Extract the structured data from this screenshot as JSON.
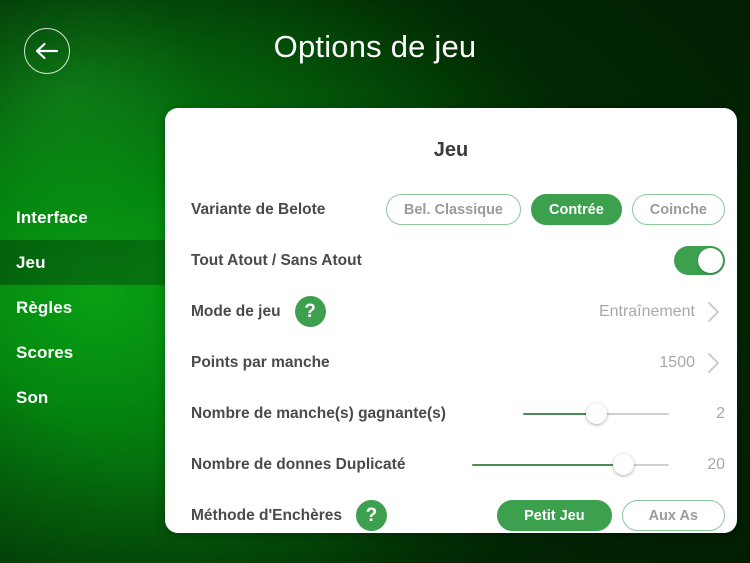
{
  "header": {
    "title": "Options de jeu",
    "back_icon": "arrow-left-icon"
  },
  "sidebar": {
    "items": [
      {
        "label": "Interface",
        "selected": false
      },
      {
        "label": "Jeu",
        "selected": true
      },
      {
        "label": "Règles",
        "selected": false
      },
      {
        "label": "Scores",
        "selected": false
      },
      {
        "label": "Son",
        "selected": false
      }
    ]
  },
  "panel": {
    "title": "Jeu",
    "rows": {
      "variante": {
        "label": "Variante de Belote",
        "options": [
          "Bel. Classique",
          "Contrée",
          "Coinche"
        ],
        "selected": "Contrée"
      },
      "tout_atout": {
        "label": "Tout Atout / Sans Atout",
        "toggle_state": "on"
      },
      "mode_de_jeu": {
        "label": "Mode de jeu",
        "help": "?",
        "value": "Entraînement",
        "chevron": "chevron-right-icon"
      },
      "points_par_manche": {
        "label": "Points par manche",
        "value": "1500",
        "chevron": "chevron-right-icon"
      },
      "manches_gagnantes": {
        "label": "Nombre de manche(s) gagnante(s)",
        "value": "2",
        "percent": 50
      },
      "donnes_duplicate": {
        "label": "Nombre de donnes Duplicaté",
        "value": "20",
        "percent": 77
      },
      "methode_encheres": {
        "label": "Méthode d'Enchères",
        "help": "?",
        "options": [
          "Petit Jeu",
          "Aux As"
        ],
        "selected": "Petit Jeu"
      }
    }
  },
  "colors": {
    "accent_green": "#3da04f",
    "pill_border": "#8cc89a",
    "muted_text": "#a8a8a8",
    "label_text": "#4a4a4a",
    "background_green": "#04870f"
  }
}
